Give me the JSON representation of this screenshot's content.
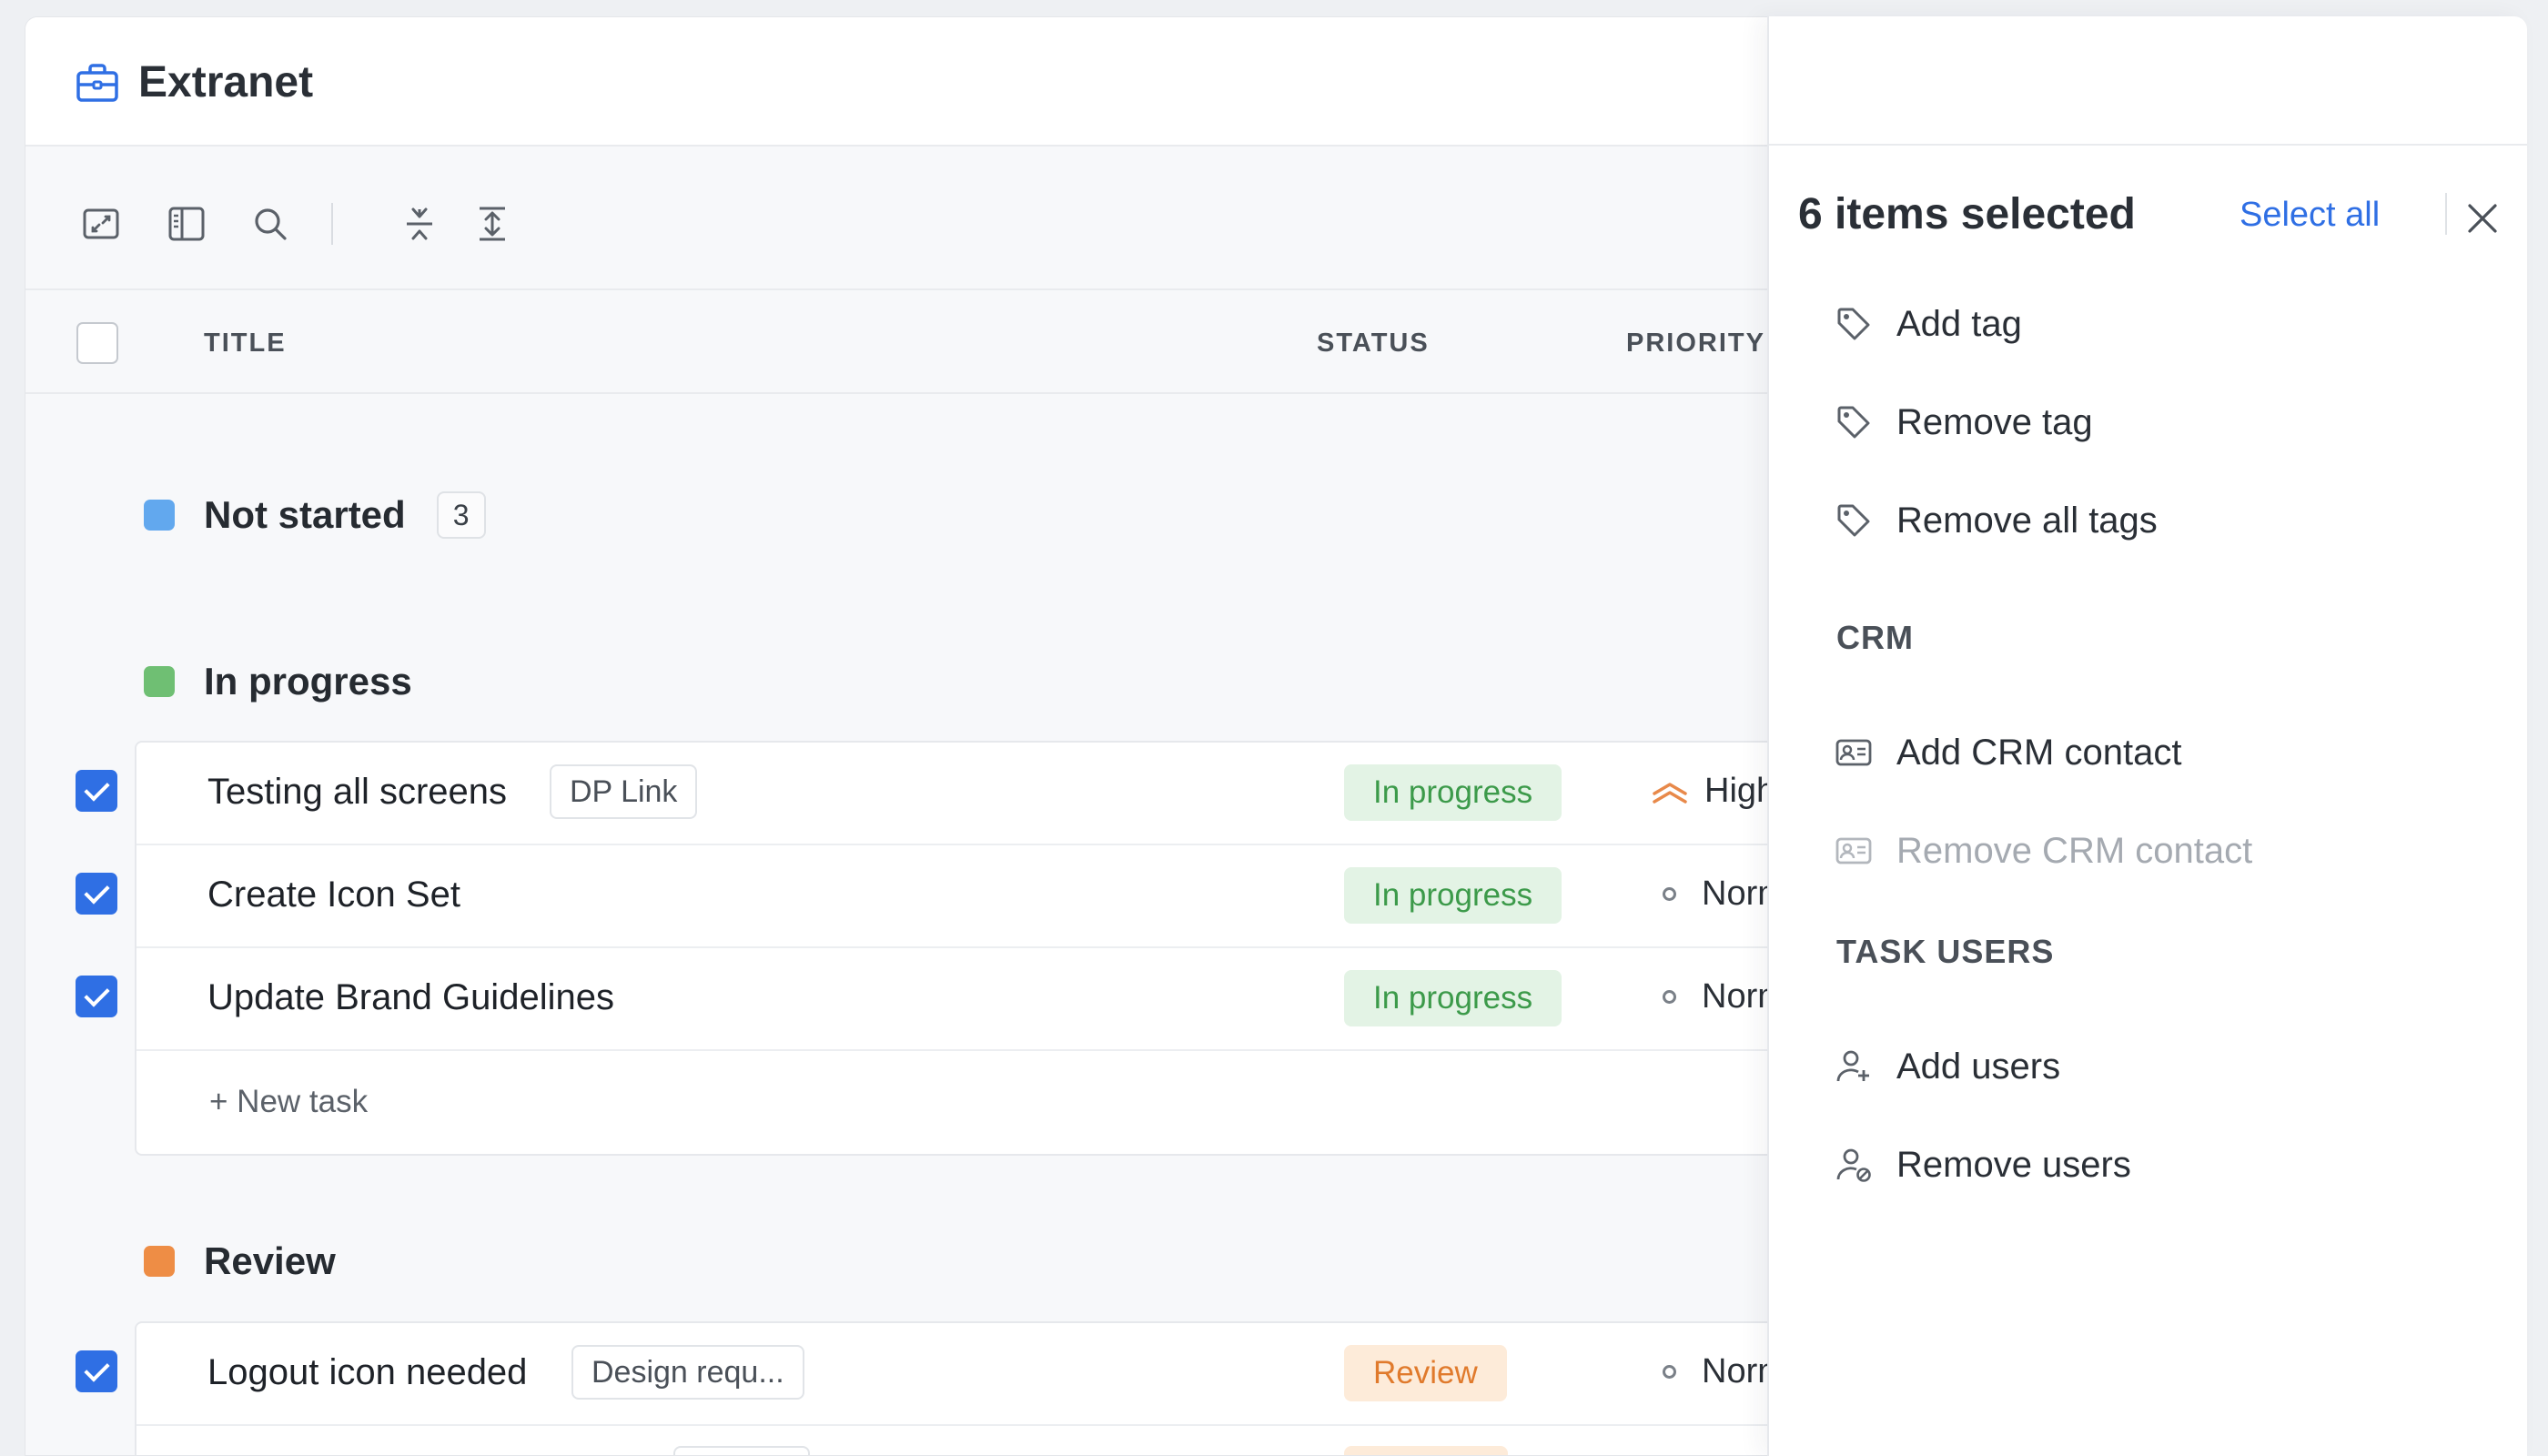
{
  "app": {
    "title": "Extranet"
  },
  "table": {
    "columns": {
      "title": "TITLE",
      "status": "STATUS",
      "priority": "PRIORITY"
    }
  },
  "groups": {
    "not_started": {
      "name": "Not started",
      "count": "3",
      "color": "#62a8ee"
    },
    "in_progress": {
      "name": "In progress",
      "color": "#6fbf73"
    },
    "review": {
      "name": "Review",
      "color": "#ee8d45"
    }
  },
  "tasks": [
    {
      "title": "Testing all screens",
      "tag": "DP Link",
      "status": "In progress",
      "priority": "High",
      "checked": true
    },
    {
      "title": "Create Icon Set",
      "tag": "",
      "status": "In progress",
      "priority": "Normal",
      "checked": true
    },
    {
      "title": "Update Brand Guidelines",
      "tag": "",
      "status": "In progress",
      "priority": "Normal",
      "checked": true
    },
    {
      "title": "Logout icon needed",
      "tag": "Design requ...",
      "status": "Review",
      "priority": "Normal",
      "checked": true
    }
  ],
  "new_task_label": "+ New task",
  "panel": {
    "title": "6 items selected",
    "select_all": "Select all",
    "items": {
      "add_tag": "Add tag",
      "remove_tag": "Remove tag",
      "remove_all_tags": "Remove all tags",
      "add_crm_contact": "Add CRM contact",
      "remove_crm_contact": "Remove CRM contact",
      "add_users": "Add users",
      "remove_users": "Remove users"
    },
    "sections": {
      "crm": "CRM",
      "task_users": "TASK USERS"
    }
  },
  "colors": {
    "accent": "#2f6fe4",
    "in_progress_bg": "#e3f3e5",
    "in_progress_fg": "#3c9a4a",
    "review_bg": "#fdebd9",
    "review_fg": "#e07a2c",
    "high_priority": "#e8894a"
  }
}
